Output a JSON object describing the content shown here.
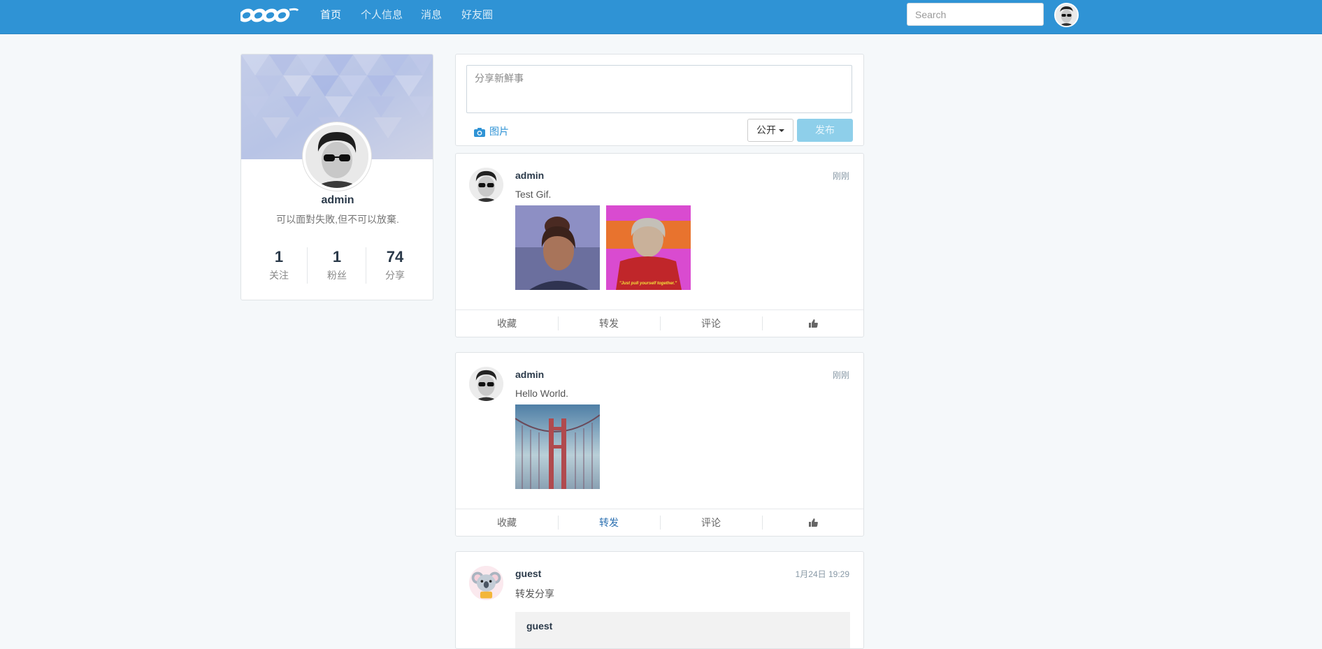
{
  "nav": {
    "items": [
      {
        "label": "首页",
        "active": true
      },
      {
        "label": "个人信息",
        "active": false
      },
      {
        "label": "消息",
        "active": false
      },
      {
        "label": "好友圈",
        "active": false
      }
    ],
    "search_placeholder": "Search",
    "brand_color": "#2f93d5"
  },
  "profile": {
    "name": "admin",
    "bio": "可以面對失敗,但不可以放棄.",
    "stats": [
      {
        "value": "1",
        "label": "关注"
      },
      {
        "value": "1",
        "label": "粉丝"
      },
      {
        "value": "74",
        "label": "分享"
      }
    ]
  },
  "compose": {
    "placeholder": "分享新鮮事",
    "photo_label": "图片",
    "visibility": "公开",
    "publish_label": "发布"
  },
  "actions": {
    "favorite": "收藏",
    "repost": "转发",
    "comment": "评论",
    "like_icon": "thumbs-up-icon"
  },
  "posts": [
    {
      "author": "admin",
      "time": "刚刚",
      "text": "Test Gif.",
      "image_captions": [
        "",
        "\"Just pull yourself together.\""
      ]
    },
    {
      "author": "admin",
      "time": "刚刚",
      "text": "Hello World."
    },
    {
      "author": "guest",
      "time": "1月24日 19:29",
      "text": "转发分享",
      "quoted_author": "guest"
    }
  ]
}
